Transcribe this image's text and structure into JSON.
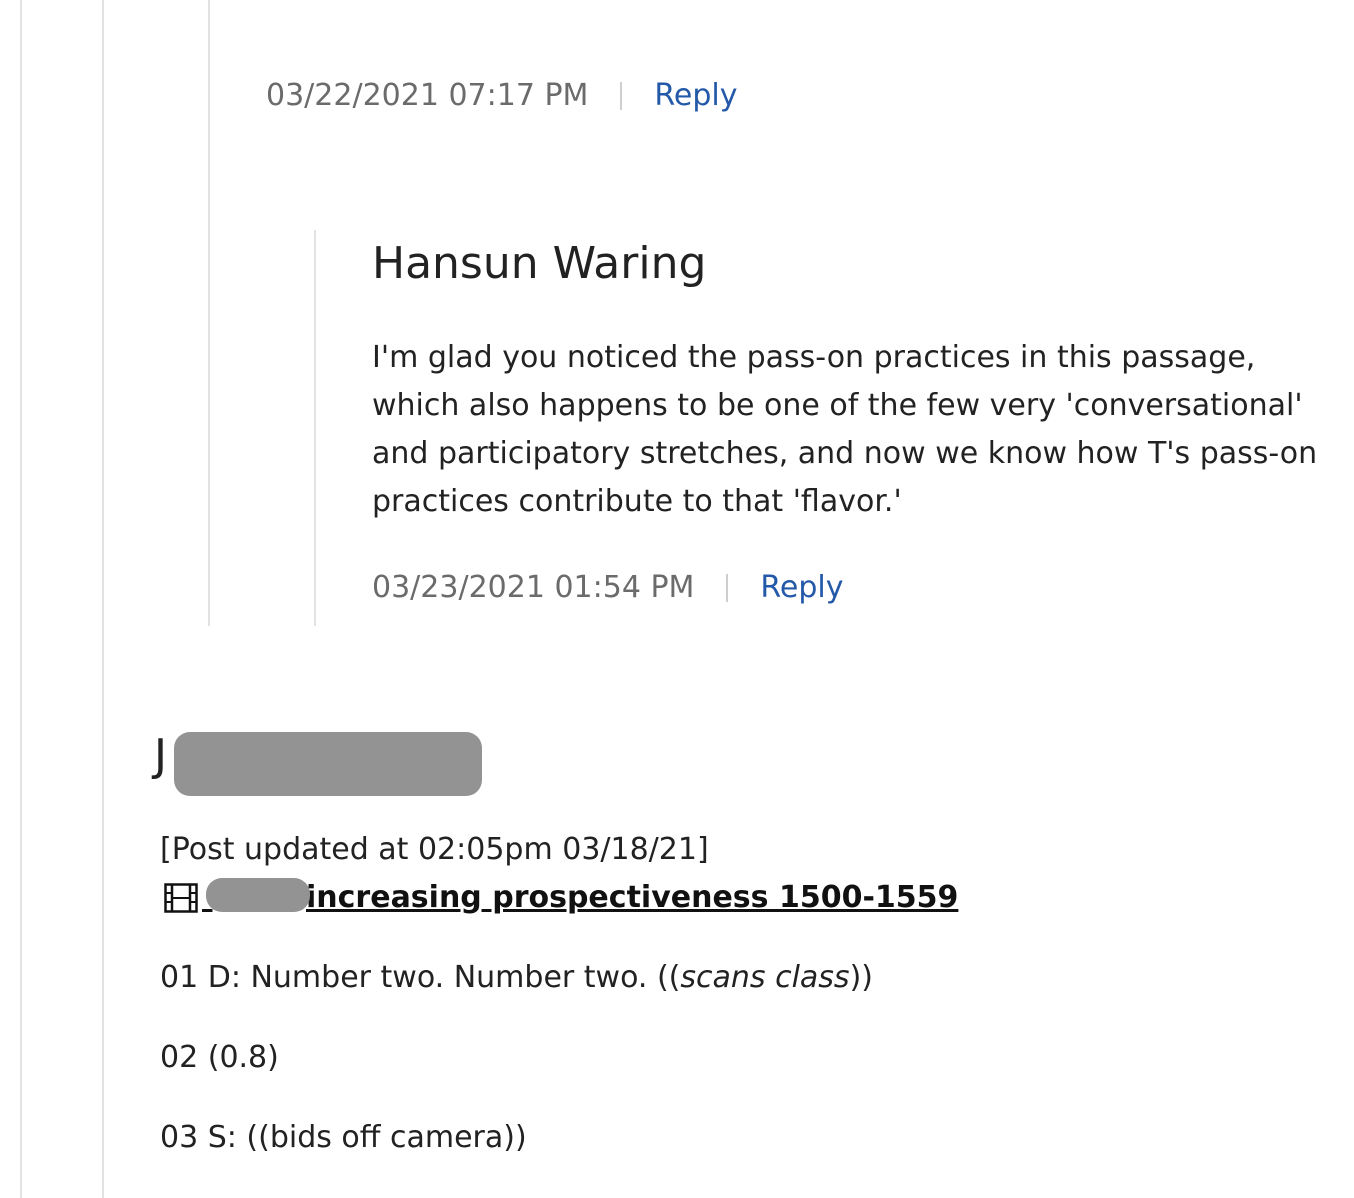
{
  "reply_1": {
    "timestamp": "03/22/2021 07:17 PM",
    "reply_label": "Reply"
  },
  "reply_2": {
    "author": "Hansun Waring",
    "body": "I'm glad you noticed the pass-on practices in this passage, which also happens to be one of the few very 'conversational' and participatory stretches, and now we know how T's pass-on practices contribute to that 'flavor.'",
    "timestamp": "03/23/2021 01:54 PM",
    "reply_label": "Reply"
  },
  "post": {
    "author_initial": "J",
    "updated_note": "[Post updated at 02:05pm 03/18/21]",
    "attachment": {
      "icon": "film-icon",
      "label": "increasing prospectiveness 1500-1559"
    },
    "lines": [
      {
        "number": "01",
        "text": "D: Number two. Number two. ((",
        "italic": "scans class",
        "tail": "))"
      },
      {
        "number": "02",
        "text": "(0.8)"
      },
      {
        "number": "03",
        "text": "S: ((bids off camera))"
      }
    ]
  },
  "colors": {
    "link": "#2359a8",
    "timestamp": "#6b6b6b",
    "redaction": "#939393",
    "thread_line": "#e2e2e2"
  }
}
